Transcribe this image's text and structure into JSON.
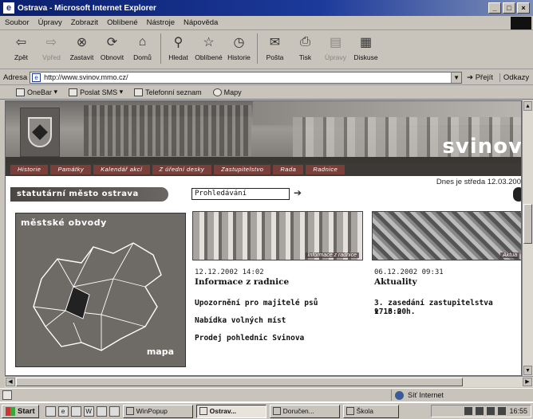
{
  "window": {
    "title": "Ostrava - Microsoft Internet Explorer",
    "controls": [
      "_",
      "□",
      "×"
    ]
  },
  "menu": [
    "Soubor",
    "Úpravy",
    "Zobrazit",
    "Oblíbené",
    "Nástroje",
    "Nápověda"
  ],
  "toolbar": [
    {
      "label": "Zpět",
      "icon": "back-arrow-icon",
      "glyph": "⇦",
      "disabled": false
    },
    {
      "label": "Vpřed",
      "icon": "forward-arrow-icon",
      "glyph": "⇨",
      "disabled": true
    },
    {
      "label": "Zastavit",
      "icon": "stop-icon",
      "glyph": "⊗",
      "disabled": false
    },
    {
      "label": "Obnovit",
      "icon": "refresh-icon",
      "glyph": "⟳",
      "disabled": false
    },
    {
      "label": "Domů",
      "icon": "home-icon",
      "glyph": "⌂",
      "disabled": false
    },
    {
      "label": "Hledat",
      "icon": "search-icon",
      "glyph": "⚲",
      "disabled": false
    },
    {
      "label": "Oblíbené",
      "icon": "favorites-icon",
      "glyph": "☆",
      "disabled": false
    },
    {
      "label": "Historie",
      "icon": "history-icon",
      "glyph": "◷",
      "disabled": false
    },
    {
      "label": "Pošta",
      "icon": "mail-icon",
      "glyph": "✉",
      "disabled": false
    },
    {
      "label": "Tisk",
      "icon": "print-icon",
      "glyph": "⎙",
      "disabled": false
    },
    {
      "label": "Úpravy",
      "icon": "edit-icon",
      "glyph": "▤",
      "disabled": true
    },
    {
      "label": "Diskuse",
      "icon": "discuss-icon",
      "glyph": "▦",
      "disabled": false
    }
  ],
  "address": {
    "label": "Adresa",
    "url": "http://www.svinov.mmo.cz/",
    "go": "Přejít",
    "links": "Odkazy"
  },
  "links": [
    "OneBar",
    "Poslat SMS",
    "Telefonní seznam",
    "Mapy"
  ],
  "page": {
    "city_name": "svinov",
    "nav": [
      "Historie",
      "Památky",
      "Kalendář akcí",
      "Z úřední desky",
      "Zastupitelstvo",
      "Rada",
      "Radnice"
    ],
    "date_line": "Dnes je středa 12.03.200",
    "city_band": "statutární město ostrava",
    "search_placeholder": "Prohledávání",
    "search_go": "➔",
    "map": {
      "title": "městské obvody",
      "label": "mapa"
    },
    "news": [
      {
        "caption": "Informace z radnice",
        "date": "12.12.2002 14:02",
        "title": "Informace z radnice",
        "links": [
          "Upozornění pro majitelé psů",
          "Nabídka volných míst",
          "Prodej pohlednic Svinova"
        ]
      },
      {
        "caption": "Aktua",
        "date": "06.12.2002 09:31",
        "title": "Aktuality",
        "links": [
          "3. zasedání zastupitelstva 17.3.2",
          "v 16:00h."
        ]
      }
    ]
  },
  "status": {
    "zone": "Síť Internet"
  },
  "taskbar": {
    "start": "Start",
    "tasks": [
      {
        "label": "WinPopup",
        "active": false
      },
      {
        "label": "Ostrav...",
        "active": true
      },
      {
        "label": "Doručen...",
        "active": false
      },
      {
        "label": "Škola",
        "active": false
      }
    ],
    "clock": "16:55"
  }
}
